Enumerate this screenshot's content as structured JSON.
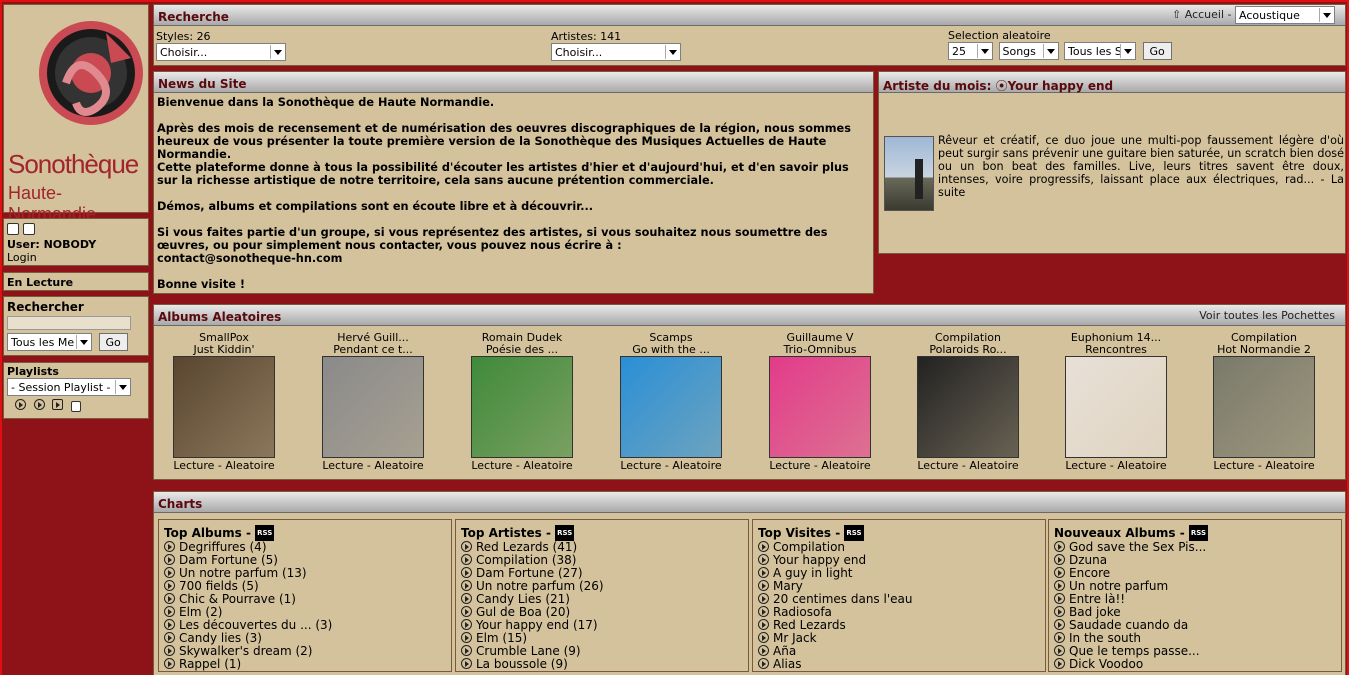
{
  "logo": {
    "line1": "Sonothèque",
    "line2": "Haute-Normandie"
  },
  "user": {
    "label": "User: NOBODY",
    "login": "Login"
  },
  "sidebar": {
    "en_lecture": "En Lecture",
    "rechercher": "Rechercher",
    "search_value": "",
    "search_scope": "Tous les Me",
    "go": "Go",
    "playlists": "Playlists",
    "playlist_select": "- Session Playlist -"
  },
  "recherche": {
    "title": "Recherche",
    "accueil": "Accueil",
    "accueil_sep": "-",
    "genre": "Acoustique",
    "styles_label": "Styles: 26",
    "styles_select": "Choisir...",
    "artistes_label": "Artistes: 141",
    "artistes_select": "Choisir...",
    "aleatoire_label": "Selection aleatoire",
    "count": "25",
    "type": "Songs",
    "scope": "Tous les S",
    "go": "Go"
  },
  "news": {
    "title": "News du Site",
    "p1": "Bienvenue dans la Sonothèque de Haute Normandie.",
    "p2": "Après des mois de recensement et de numérisation des oeuvres discographiques de la région, nous sommes heureux de vous présenter la toute première version de la Sonothèque des Musiques Actuelles de Haute Normandie.",
    "p3": "Cette plateforme donne à tous la possibilité d'écouter les artistes d'hier et d'aujourd'hui, et d'en savoir plus sur la richesse artistique de notre territoire, cela sans aucune prétention commerciale.",
    "p4": "Démos, albums et compilations sont en écoute libre et à découvrir...",
    "p5": "Si vous faites partie d'un groupe, si vous représentez des artistes, si vous souhaitez nous soumettre des œuvres, ou pour simplement nous contacter, vous pouvez nous écrire à :",
    "p6": "contact@sonotheque-hn.com",
    "p7": "Bonne visite !"
  },
  "artiste": {
    "title": "Artiste du mois:",
    "name": "Your happy end",
    "text": "Rêveur et créatif, ce duo joue une multi-pop faussement légère d'où peut surgir sans prévenir une guitare bien saturée, un scratch bien dosé ou un bon beat des familles. Live, leurs titres savent être doux, intenses, voire progressifs, laissant place aux électriques, rad... - La suite"
  },
  "albums": {
    "title": "Albums Aleatoires",
    "voir": "Voir toutes les Pochettes",
    "lecture": "Lecture",
    "sep": "-",
    "aleatoire": "Aleatoire",
    "items": [
      {
        "artist": "SmallPox",
        "album": "Just Kiddin'",
        "cover_color": "#5a4630"
      },
      {
        "artist": "Hervé Guill...",
        "album": "Pendant ce t...",
        "cover_color": "#8a8a8a"
      },
      {
        "artist": "Romain Dudek",
        "album": "Poésie des ...",
        "cover_color": "#3f8a3a"
      },
      {
        "artist": "Scamps",
        "album": "Go with the ...",
        "cover_color": "#2a8fd6"
      },
      {
        "artist": "Guillaume V",
        "album": "Trio-Omnibus",
        "cover_color": "#e33b8a"
      },
      {
        "artist": "Compilation",
        "album": "Polaroids Ro...",
        "cover_color": "#222222"
      },
      {
        "artist": "Euphonium 14...",
        "album": "Rencontres",
        "cover_color": "#e8e0d8"
      },
      {
        "artist": "Compilation",
        "album": "Hot Normandie 2",
        "cover_color": "#7a7a6a"
      }
    ]
  },
  "charts": {
    "title": "Charts",
    "rss": "RSS",
    "cols": [
      {
        "title": "Top Albums -",
        "items": [
          "Degriffures (4)",
          "Dam Fortune (5)",
          "Un notre parfum (13)",
          "700 fields (5)",
          "Chic & Pourrave (1)",
          "Elm (2)",
          "Les découvertes du ... (3)",
          "Candy lies (3)",
          "Skywalker's dream (2)",
          "Rappel (1)"
        ]
      },
      {
        "title": "Top Artistes -",
        "items": [
          "Red Lezards (41)",
          "Compilation (38)",
          "Dam Fortune (27)",
          "Un notre parfum (26)",
          "Candy Lies (21)",
          "Gul de Boa (20)",
          "Your happy end (17)",
          "Elm (15)",
          "Crumble Lane (9)",
          "La boussole (9)"
        ]
      },
      {
        "title": "Top Visites -",
        "items": [
          "Compilation",
          "Your happy end",
          "A guy in light",
          "Mary",
          "20 centimes dans l'eau",
          "Radiosofa",
          "Red Lezards",
          "Mr Jack",
          "Aña",
          "Alias"
        ]
      },
      {
        "title": "Nouveaux Albums -",
        "items": [
          "God save the Sex Pis...",
          "Dzuna",
          "Encore",
          "Un notre parfum",
          "Entre là!!",
          "Bad joke",
          "Saudade cuando da",
          "In the south",
          "Que le temps passe...",
          "Dick Voodoo"
        ]
      }
    ]
  }
}
